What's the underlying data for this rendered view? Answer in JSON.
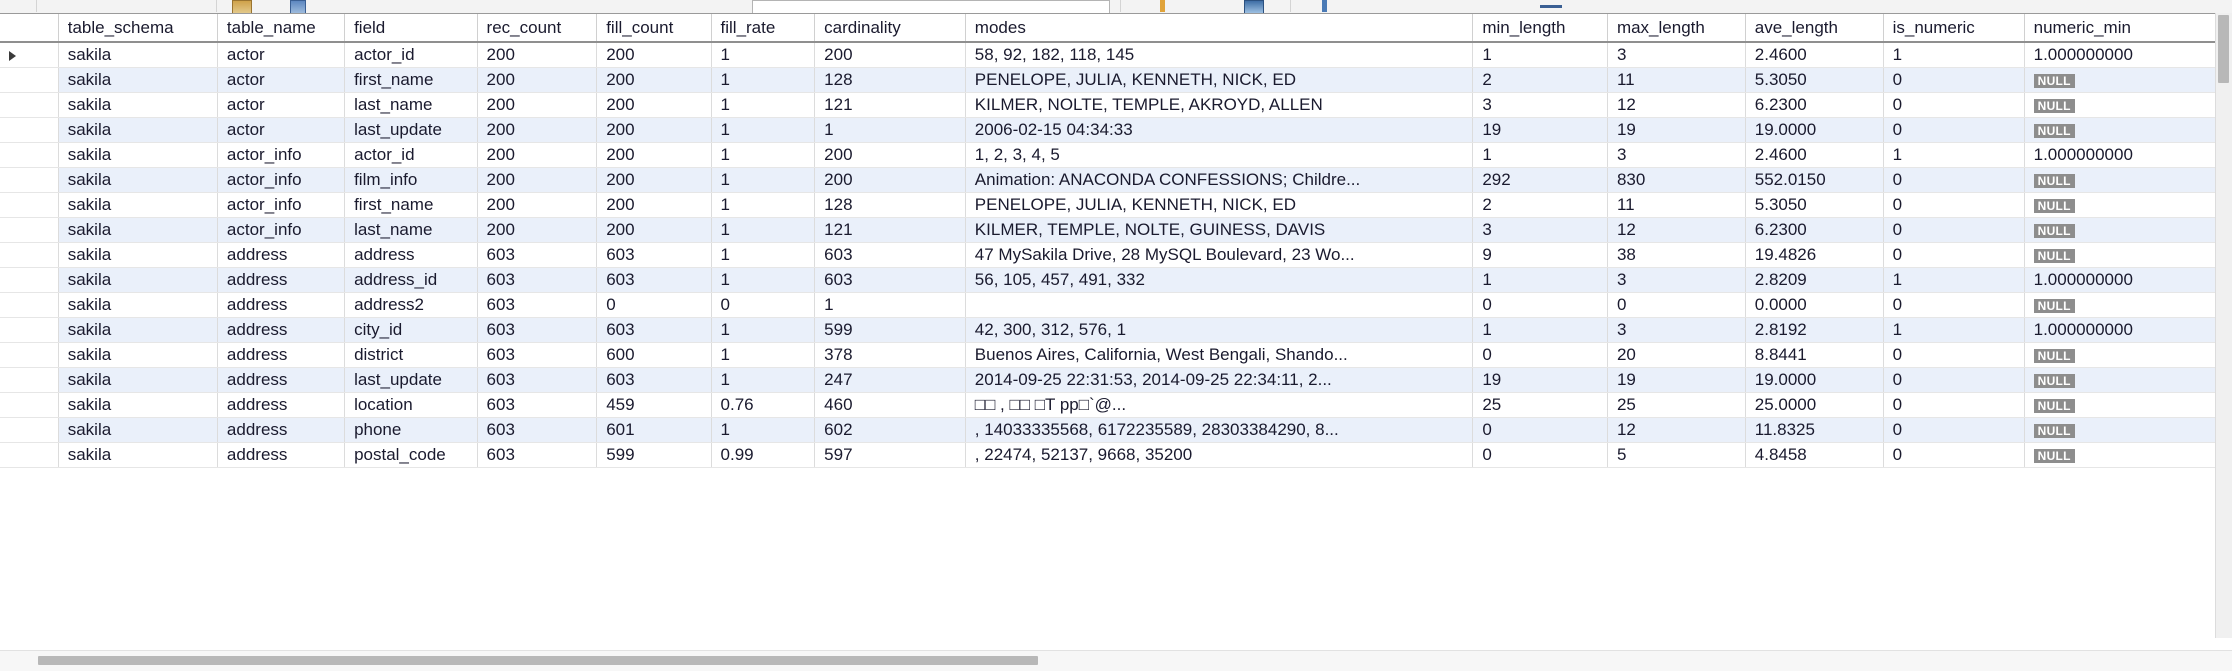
{
  "toolbar": {
    "icons": [
      "save-icon",
      "revert-icon",
      "grid-icon",
      "amber-marker-icon",
      "blue-marker-icon",
      "underline-icon"
    ],
    "search_value": "",
    "search_placeholder": ""
  },
  "grid": {
    "columns": [
      {
        "key": "gutter",
        "label": ""
      },
      {
        "key": "table_schema",
        "label": "table_schema"
      },
      {
        "key": "table_name",
        "label": "table_name"
      },
      {
        "key": "field",
        "label": "field"
      },
      {
        "key": "rec_count",
        "label": "rec_count"
      },
      {
        "key": "fill_count",
        "label": "fill_count"
      },
      {
        "key": "fill_rate",
        "label": "fill_rate"
      },
      {
        "key": "cardinality",
        "label": "cardinality"
      },
      {
        "key": "modes",
        "label": "modes"
      },
      {
        "key": "min_length",
        "label": "min_length"
      },
      {
        "key": "max_length",
        "label": "max_length"
      },
      {
        "key": "ave_length",
        "label": "ave_length"
      },
      {
        "key": "is_numeric",
        "label": "is_numeric"
      },
      {
        "key": "numeric_min",
        "label": "numeric_min"
      }
    ],
    "null_label": "NULL",
    "selected_row_index": 0,
    "rows": [
      {
        "table_schema": "sakila",
        "table_name": "actor",
        "field": "actor_id",
        "rec_count": "200",
        "fill_count": "200",
        "fill_rate": "1",
        "cardinality": "200",
        "modes": "58, 92, 182, 118, 145",
        "min_length": "1",
        "max_length": "3",
        "ave_length": "2.4600",
        "is_numeric": "1",
        "numeric_min": "1.000000000"
      },
      {
        "table_schema": "sakila",
        "table_name": "actor",
        "field": "first_name",
        "rec_count": "200",
        "fill_count": "200",
        "fill_rate": "1",
        "cardinality": "128",
        "modes": "PENELOPE, JULIA, KENNETH, NICK, ED",
        "min_length": "2",
        "max_length": "11",
        "ave_length": "5.3050",
        "is_numeric": "0",
        "numeric_min": null
      },
      {
        "table_schema": "sakila",
        "table_name": "actor",
        "field": "last_name",
        "rec_count": "200",
        "fill_count": "200",
        "fill_rate": "1",
        "cardinality": "121",
        "modes": "KILMER, NOLTE, TEMPLE, AKROYD, ALLEN",
        "min_length": "3",
        "max_length": "12",
        "ave_length": "6.2300",
        "is_numeric": "0",
        "numeric_min": null
      },
      {
        "table_schema": "sakila",
        "table_name": "actor",
        "field": "last_update",
        "rec_count": "200",
        "fill_count": "200",
        "fill_rate": "1",
        "cardinality": "1",
        "modes": "2006-02-15 04:34:33",
        "min_length": "19",
        "max_length": "19",
        "ave_length": "19.0000",
        "is_numeric": "0",
        "numeric_min": null
      },
      {
        "table_schema": "sakila",
        "table_name": "actor_info",
        "field": "actor_id",
        "rec_count": "200",
        "fill_count": "200",
        "fill_rate": "1",
        "cardinality": "200",
        "modes": "1, 2, 3, 4, 5",
        "min_length": "1",
        "max_length": "3",
        "ave_length": "2.4600",
        "is_numeric": "1",
        "numeric_min": "1.000000000"
      },
      {
        "table_schema": "sakila",
        "table_name": "actor_info",
        "field": "film_info",
        "rec_count": "200",
        "fill_count": "200",
        "fill_rate": "1",
        "cardinality": "200",
        "modes": "Animation: ANACONDA CONFESSIONS; Childre...",
        "min_length": "292",
        "max_length": "830",
        "ave_length": "552.0150",
        "is_numeric": "0",
        "numeric_min": null
      },
      {
        "table_schema": "sakila",
        "table_name": "actor_info",
        "field": "first_name",
        "rec_count": "200",
        "fill_count": "200",
        "fill_rate": "1",
        "cardinality": "128",
        "modes": "PENELOPE, JULIA, KENNETH, NICK, ED",
        "min_length": "2",
        "max_length": "11",
        "ave_length": "5.3050",
        "is_numeric": "0",
        "numeric_min": null
      },
      {
        "table_schema": "sakila",
        "table_name": "actor_info",
        "field": "last_name",
        "rec_count": "200",
        "fill_count": "200",
        "fill_rate": "1",
        "cardinality": "121",
        "modes": "KILMER, TEMPLE, NOLTE, GUINESS, DAVIS",
        "min_length": "3",
        "max_length": "12",
        "ave_length": "6.2300",
        "is_numeric": "0",
        "numeric_min": null
      },
      {
        "table_schema": "sakila",
        "table_name": "address",
        "field": "address",
        "rec_count": "603",
        "fill_count": "603",
        "fill_rate": "1",
        "cardinality": "603",
        "modes": "47 MySakila Drive, 28 MySQL Boulevard, 23 Wo...",
        "min_length": "9",
        "max_length": "38",
        "ave_length": "19.4826",
        "is_numeric": "0",
        "numeric_min": null
      },
      {
        "table_schema": "sakila",
        "table_name": "address",
        "field": "address_id",
        "rec_count": "603",
        "fill_count": "603",
        "fill_rate": "1",
        "cardinality": "603",
        "modes": "56, 105, 457, 491, 332",
        "min_length": "1",
        "max_length": "3",
        "ave_length": "2.8209",
        "is_numeric": "1",
        "numeric_min": "1.000000000"
      },
      {
        "table_schema": "sakila",
        "table_name": "address",
        "field": "address2",
        "rec_count": "603",
        "fill_count": "0",
        "fill_rate": "0",
        "cardinality": "1",
        "modes": "",
        "min_length": "0",
        "max_length": "0",
        "ave_length": "0.0000",
        "is_numeric": "0",
        "numeric_min": null
      },
      {
        "table_schema": "sakila",
        "table_name": "address",
        "field": "city_id",
        "rec_count": "603",
        "fill_count": "603",
        "fill_rate": "1",
        "cardinality": "599",
        "modes": "42, 300, 312, 576, 1",
        "min_length": "1",
        "max_length": "3",
        "ave_length": "2.8192",
        "is_numeric": "1",
        "numeric_min": "1.000000000"
      },
      {
        "table_schema": "sakila",
        "table_name": "address",
        "field": "district",
        "rec_count": "603",
        "fill_count": "600",
        "fill_rate": "1",
        "cardinality": "378",
        "modes": "Buenos Aires, California, West Bengali, Shando...",
        "min_length": "0",
        "max_length": "20",
        "ave_length": "8.8441",
        "is_numeric": "0",
        "numeric_min": null
      },
      {
        "table_schema": "sakila",
        "table_name": "address",
        "field": "last_update",
        "rec_count": "603",
        "fill_count": "603",
        "fill_rate": "1",
        "cardinality": "247",
        "modes": "2014-09-25 22:31:53, 2014-09-25 22:34:11, 2...",
        "min_length": "19",
        "max_length": "19",
        "ave_length": "19.0000",
        "is_numeric": "0",
        "numeric_min": null
      },
      {
        "table_schema": "sakila",
        "table_name": "address",
        "field": "location",
        "rec_count": "603",
        "fill_count": "459",
        "fill_rate": "0.76",
        "cardinality": "460",
        "modes": "    □□                          ,      □□   □T pp□`@...",
        "min_length": "25",
        "max_length": "25",
        "ave_length": "25.0000",
        "is_numeric": "0",
        "numeric_min": null
      },
      {
        "table_schema": "sakila",
        "table_name": "address",
        "field": "phone",
        "rec_count": "603",
        "fill_count": "601",
        "fill_rate": "1",
        "cardinality": "602",
        "modes": ", 14033335568, 6172235589, 28303384290, 8...",
        "min_length": "0",
        "max_length": "12",
        "ave_length": "11.8325",
        "is_numeric": "0",
        "numeric_min": null
      },
      {
        "table_schema": "sakila",
        "table_name": "address",
        "field": "postal_code",
        "rec_count": "603",
        "fill_count": "599",
        "fill_rate": "0.99",
        "cardinality": "597",
        "modes": ", 22474, 52137, 9668, 35200",
        "min_length": "0",
        "max_length": "5",
        "ave_length": "4.8458",
        "is_numeric": "0",
        "numeric_min": null
      }
    ]
  },
  "scrollbars": {
    "vertical": "vertical-scrollbar",
    "horizontal": "horizontal-scrollbar"
  }
}
